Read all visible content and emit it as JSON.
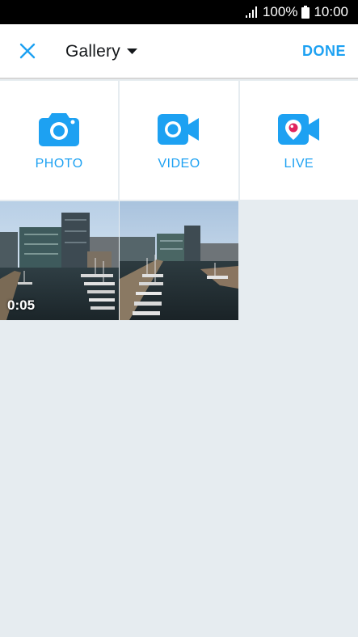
{
  "status_bar": {
    "battery": "100%",
    "time": "10:00",
    "signal_icon": "signal-icon",
    "battery_icon": "battery-icon"
  },
  "toolbar": {
    "close_icon": "close-icon",
    "gallery_label": "Gallery",
    "dropdown_icon": "caret-down-icon",
    "done_label": "DONE"
  },
  "capture_options": [
    {
      "label": "PHOTO",
      "icon": "camera-icon"
    },
    {
      "label": "VIDEO",
      "icon": "video-camera-icon"
    },
    {
      "label": "LIVE",
      "icon": "periscope-live-icon"
    }
  ],
  "gallery": {
    "items": [
      {
        "type": "video",
        "duration": "0:05"
      },
      {
        "type": "photo"
      }
    ]
  },
  "colors": {
    "accent": "#1da1f2",
    "background": "#e6ecf0",
    "live": "#e0245e"
  }
}
